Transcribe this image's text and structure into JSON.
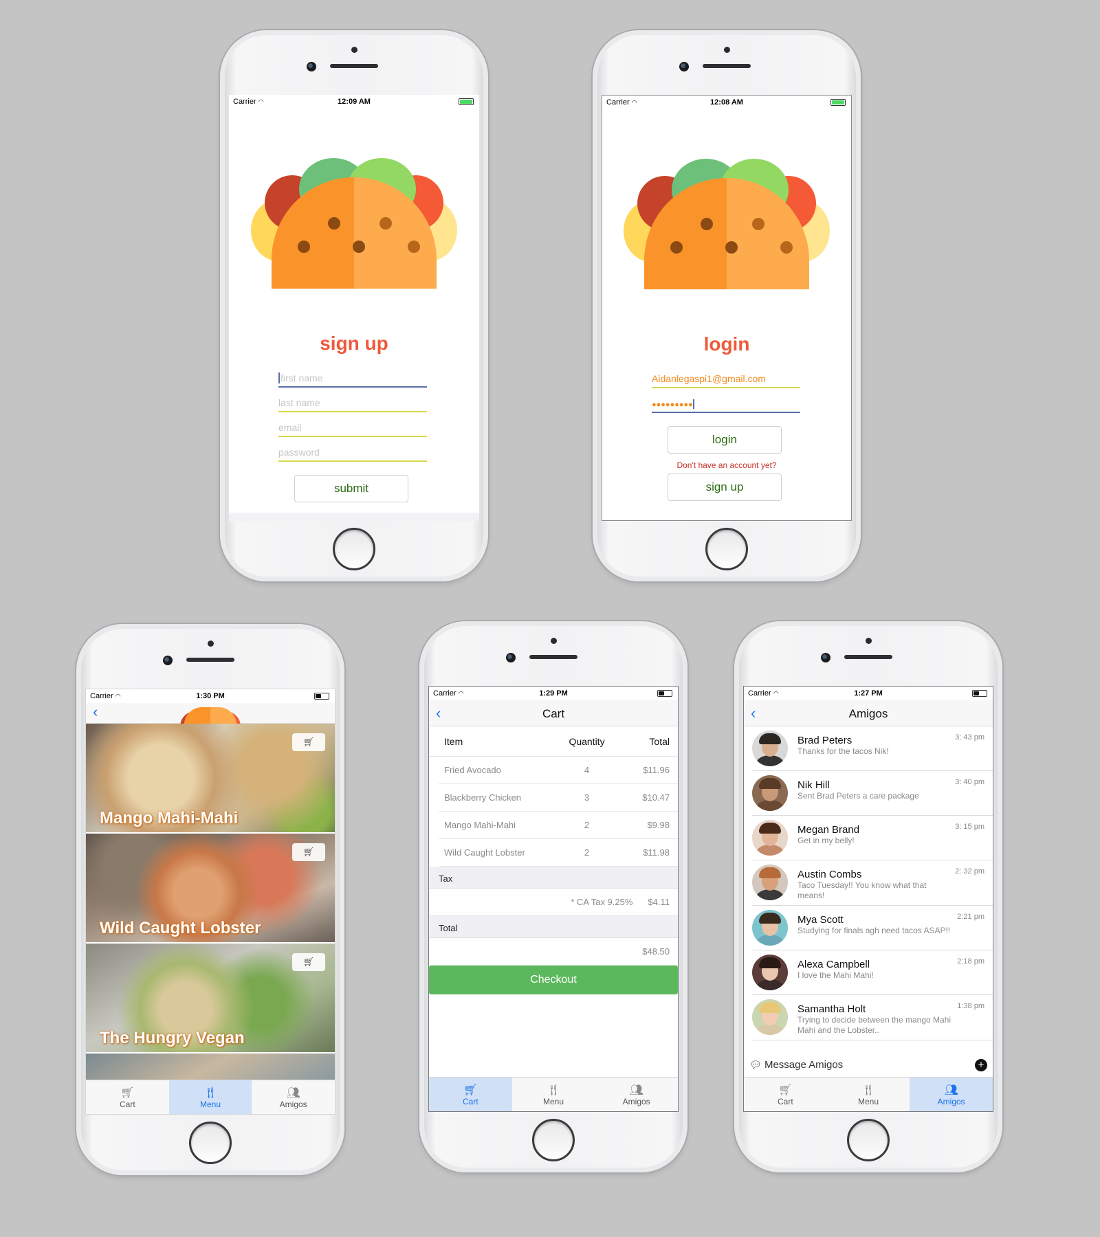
{
  "signup": {
    "status": {
      "carrier": "Carrier",
      "time": "12:09 AM"
    },
    "title": "sign up",
    "fields": [
      {
        "placeholder": "first name",
        "value": ""
      },
      {
        "placeholder": "last name",
        "value": ""
      },
      {
        "placeholder": "email",
        "value": ""
      },
      {
        "placeholder": "password",
        "value": ""
      }
    ],
    "submit": "submit"
  },
  "login": {
    "status": {
      "carrier": "Carrier",
      "time": "12:08 AM"
    },
    "title": "login",
    "email": "Aidanlegaspi1@gmail.com",
    "password_mask": "●●●●●●●●●",
    "login_button": "login",
    "no_account": "Don't have an account yet?",
    "signup_button": "sign up"
  },
  "menu": {
    "status": {
      "carrier": "Carrier",
      "time": "1:30 PM"
    },
    "items": [
      {
        "name": "Mango Mahi-Mahi"
      },
      {
        "name": "Wild Caught Lobster"
      },
      {
        "name": "The Hungry Vegan"
      }
    ]
  },
  "cart": {
    "status": {
      "carrier": "Carrier",
      "time": "1:29 PM"
    },
    "title": "Cart",
    "headers": {
      "item": "Item",
      "quantity": "Quantity",
      "total": "Total"
    },
    "rows": [
      {
        "item": "Fried Avocado",
        "quantity": "4",
        "total": "$11.96"
      },
      {
        "item": "Blackberry Chicken",
        "quantity": "3",
        "total": "$10.47"
      },
      {
        "item": "Mango Mahi-Mahi",
        "quantity": "2",
        "total": "$9.98"
      },
      {
        "item": "Wild Caught Lobster",
        "quantity": "2",
        "total": "$11.98"
      }
    ],
    "tax_label": "Tax",
    "tax_note": "* CA Tax 9.25%",
    "tax_value": "$4.11",
    "total_label": "Total",
    "total_value": "$48.50",
    "checkout": "Checkout"
  },
  "amigos": {
    "status": {
      "carrier": "Carrier",
      "time": "1:27 PM"
    },
    "title": "Amigos",
    "list": [
      {
        "name": "Brad Peters",
        "message": "Thanks for the tacos Nik!",
        "time": "3: 43 pm",
        "skin": "#d9b08f",
        "hair": "#2b2622",
        "shirt": "#333333",
        "bg": "#d8d8d8"
      },
      {
        "name": "Nik Hill",
        "message": "Sent Brad Peters a care package",
        "time": "3: 40 pm",
        "skin": "#c99a78",
        "hair": "#5a3b26",
        "shirt": "#6b4a33",
        "bg": "#8a6a52"
      },
      {
        "name": "Megan Brand",
        "message": "Get in my belly!",
        "time": "3: 15 pm",
        "skin": "#e2b59a",
        "hair": "#4a2a1a",
        "shirt": "#c48a6a",
        "bg": "#e8d6c8"
      },
      {
        "name": "Austin Combs",
        "message": "Taco Tuesday!! You know what that means!",
        "time": "2: 32 pm",
        "skin": "#d9a07c",
        "hair": "#b86b3a",
        "shirt": "#3a3a3a",
        "bg": "#d4c7bd"
      },
      {
        "name": "Mya Scott",
        "message": "Studying for finals agh need tacos ASAP!!",
        "time": "2:21 pm",
        "skin": "#e8c1a6",
        "hair": "#3a2a1e",
        "shirt": "#6aa8b8",
        "bg": "#7ec4cc"
      },
      {
        "name": "Alexa Campbell",
        "message": "I love the Mahi Mahi!",
        "time": "2:18 pm",
        "skin": "#ecc7b0",
        "hair": "#2a1a16",
        "shirt": "#3a2a2a",
        "bg": "#5c3d3a"
      },
      {
        "name": "Samantha Holt",
        "message": "Trying to decide between the mango Mahi Mahi and the Lobster..",
        "time": "1:38 pm",
        "skin": "#f0cdb3",
        "hair": "#e8c877",
        "shirt": "#d8c8a8",
        "bg": "#c9d6b0"
      }
    ],
    "message_bar": "Message Amigos"
  },
  "tabs": {
    "cart": "Cart",
    "menu": "Menu",
    "amigos": "Amigos"
  },
  "colors": {
    "accent": "#1a73e8",
    "brand": "#ee5a3b",
    "checkout": "#5cb85c"
  }
}
